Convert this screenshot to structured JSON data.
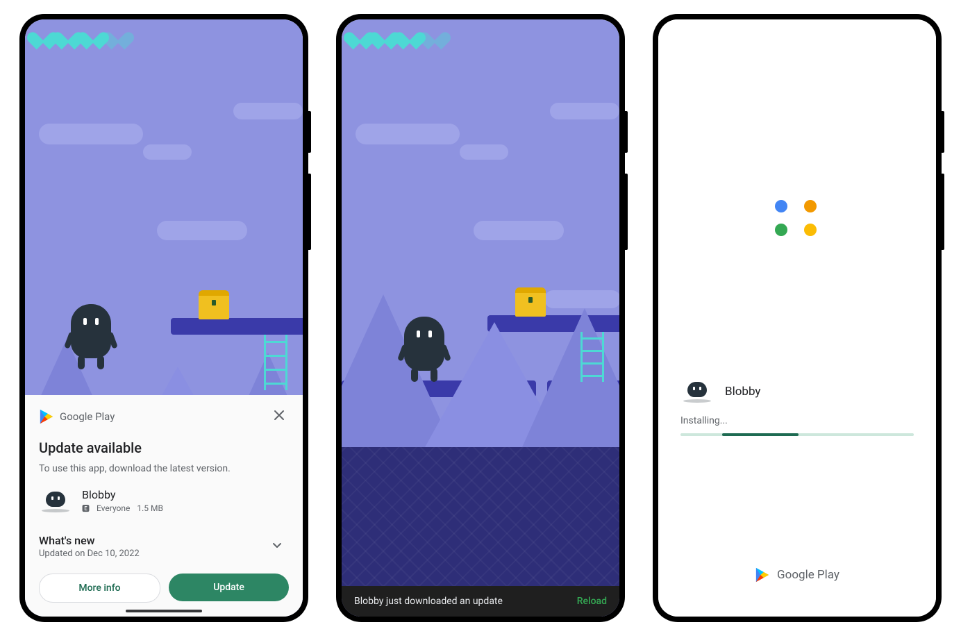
{
  "gplay_label": "Google Play",
  "phone1": {
    "sheet": {
      "title": "Update available",
      "subtitle": "To use this app, download the latest version.",
      "app_name": "Blobby",
      "rating_label": "Everyone",
      "size": "1.5 MB",
      "whats_new_title": "What's new",
      "whats_new_date": "Updated on Dec 10, 2022",
      "more_info": "More info",
      "update": "Update"
    }
  },
  "phone2": {
    "snackbar_text": "Blobby just downloaded an update",
    "snackbar_action": "Reload"
  },
  "phone3": {
    "app_name": "Blobby",
    "status": "Installing..."
  }
}
